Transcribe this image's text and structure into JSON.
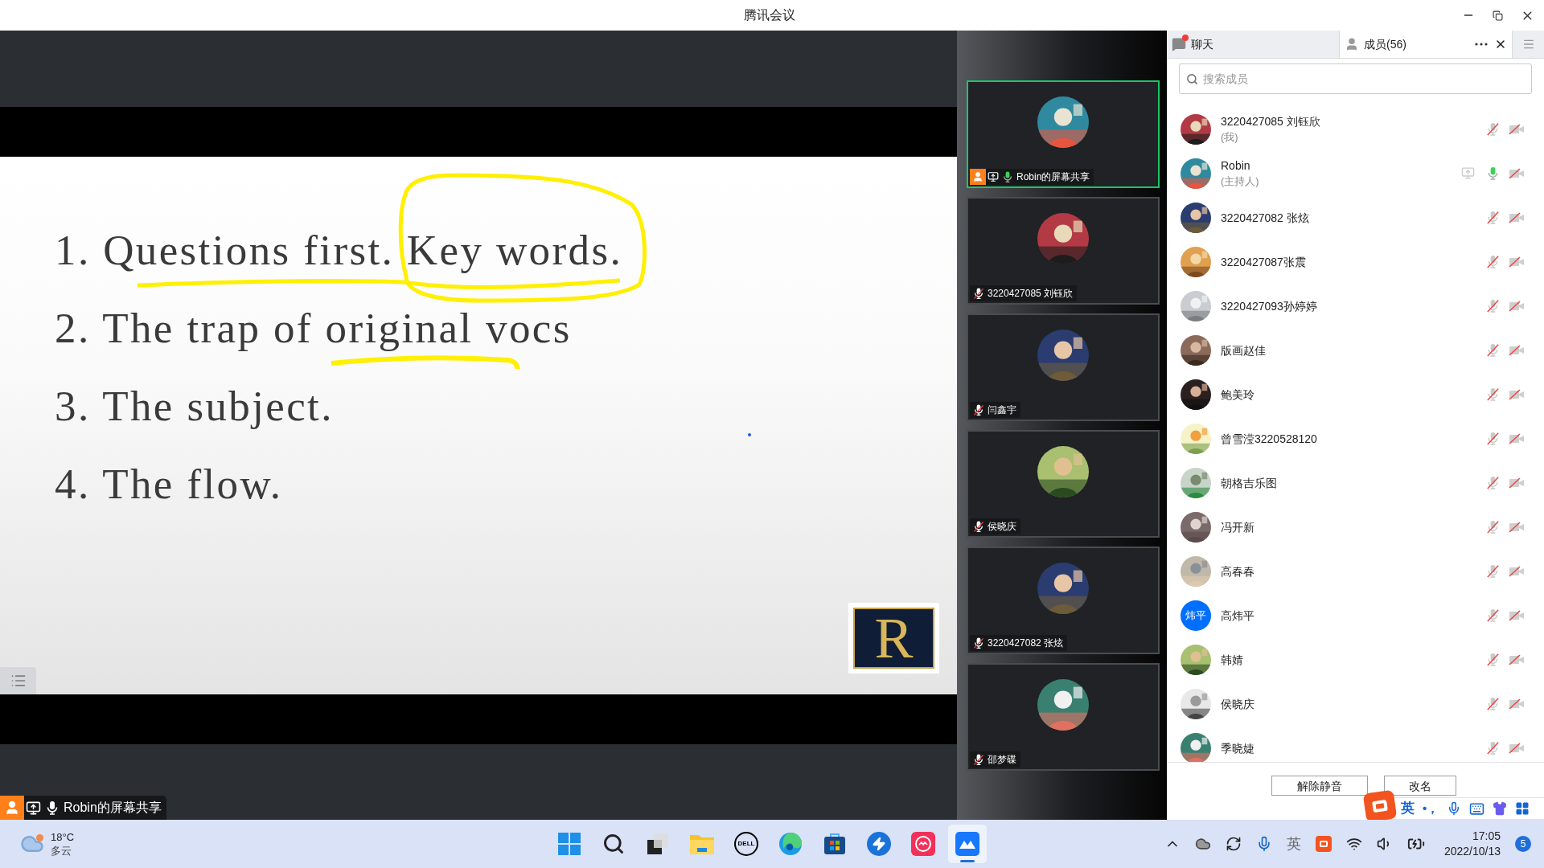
{
  "window": {
    "title": "腾讯会议"
  },
  "slide": {
    "lines": [
      "1. Questions first. Key words.",
      "2. The trap of original vocs",
      "3. The subject.",
      "4. The flow."
    ],
    "logo": "R"
  },
  "sharer_label": {
    "text": "Robin的屏幕共享",
    "muted": false
  },
  "tiles": [
    {
      "name": "Robin的屏幕共享",
      "muted": false,
      "active": true,
      "host": true
    },
    {
      "name": "3220427085 刘钰欣",
      "muted": true,
      "active": false,
      "host": false
    },
    {
      "name": "闫鑫宇",
      "muted": true,
      "active": false,
      "host": false
    },
    {
      "name": "侯晓庆",
      "muted": true,
      "active": false,
      "host": false
    },
    {
      "name": "3220427082 张炫",
      "muted": true,
      "active": false,
      "host": false
    },
    {
      "name": "邵梦碟",
      "muted": true,
      "active": false,
      "host": false
    }
  ],
  "panel": {
    "tabs": [
      {
        "label": "聊天",
        "selected": false,
        "unread": true
      },
      {
        "label": "成员(56)",
        "selected": true,
        "unread": false
      }
    ],
    "search": {
      "placeholder": "搜索成员"
    },
    "members": [
      {
        "name": "3220427085 刘钰欣",
        "role": "(我)",
        "muted": true,
        "camera_off": true,
        "sharing": false
      },
      {
        "name": "Robin",
        "role": "(主持人)",
        "muted": false,
        "camera_off": true,
        "sharing": true
      },
      {
        "name": "3220427082 张炫",
        "muted": true,
        "camera_off": true,
        "sharing": false
      },
      {
        "name": "3220427087张震",
        "muted": true,
        "camera_off": true,
        "sharing": false
      },
      {
        "name": "3220427093孙婷婷",
        "muted": true,
        "camera_off": true,
        "sharing": false
      },
      {
        "name": "版画赵佳",
        "muted": true,
        "camera_off": true,
        "sharing": false
      },
      {
        "name": "鲍美玲",
        "muted": true,
        "camera_off": true,
        "sharing": false
      },
      {
        "name": "曾雪滢3220528120",
        "muted": true,
        "camera_off": true,
        "sharing": false
      },
      {
        "name": "朝格吉乐图",
        "muted": true,
        "camera_off": true,
        "sharing": false
      },
      {
        "name": "冯开新",
        "muted": true,
        "camera_off": true,
        "sharing": false
      },
      {
        "name": "高春春",
        "muted": true,
        "camera_off": true,
        "sharing": false
      },
      {
        "name": "高炜平",
        "muted": true,
        "camera_off": true,
        "sharing": false,
        "avatar": {
          "kind": "text",
          "text": "炜平"
        }
      },
      {
        "name": "韩婧",
        "muted": true,
        "camera_off": true,
        "sharing": false
      },
      {
        "name": "侯晓庆",
        "muted": true,
        "camera_off": true,
        "sharing": false
      },
      {
        "name": "季晓婕",
        "muted": true,
        "camera_off": true,
        "sharing": false
      }
    ],
    "buttons": [
      "解除静音",
      "改名"
    ]
  },
  "ime_toolbar": {
    "mode": "英",
    "punctuation": "•，"
  },
  "taskbar": {
    "weather": {
      "temp": "18°C",
      "desc": "多云"
    },
    "apps": [
      {
        "kind": "start",
        "selected": false
      },
      {
        "kind": "search",
        "selected": false
      },
      {
        "kind": "taskview",
        "selected": false
      },
      {
        "kind": "folder",
        "selected": false
      },
      {
        "kind": "dell",
        "label": "DELL",
        "selected": false
      },
      {
        "kind": "edge",
        "selected": false
      },
      {
        "kind": "store",
        "selected": false
      },
      {
        "kind": "bolt",
        "selected": false
      },
      {
        "kind": "pink",
        "selected": false
      },
      {
        "kind": "meeting",
        "selected": true
      }
    ],
    "ime": "英",
    "time": "17:05",
    "date": "2022/10/13",
    "notifications": "5"
  }
}
